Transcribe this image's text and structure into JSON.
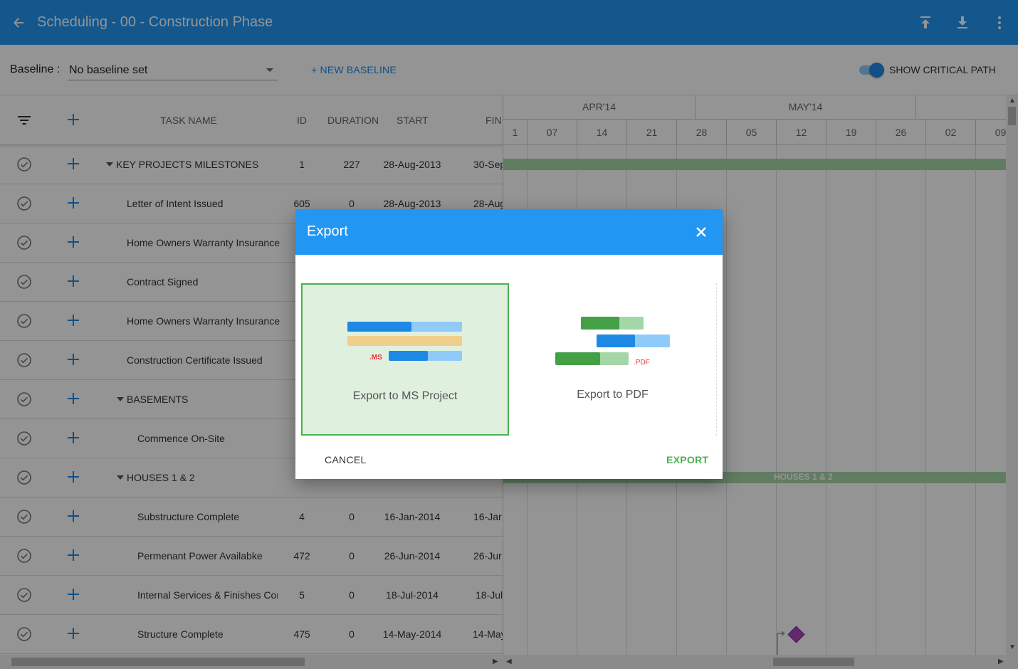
{
  "appbar": {
    "title": "Scheduling - 00 - Construction Phase",
    "icons": [
      "back-arrow-icon",
      "upload-icon",
      "download-icon",
      "more-vert-icon"
    ]
  },
  "baseline": {
    "label": "Baseline :",
    "selected": "No baseline set",
    "new_button": "+ NEW BASELINE",
    "critical_path_label": "SHOW CRITICAL PATH",
    "critical_path_on": true
  },
  "grid": {
    "columns": {
      "task_name": "TASK NAME",
      "id": "ID",
      "duration": "DURATION",
      "start": "START",
      "finish": "FIN"
    },
    "rows": [
      {
        "name": "KEY PROJECTS MILESTONES",
        "group": true,
        "indent": 0,
        "id": "1",
        "duration": "227",
        "start": "28-Aug-2013",
        "finish": "30-Sep"
      },
      {
        "name": "Letter of Intent Issued",
        "group": false,
        "indent": 1,
        "id": "605",
        "duration": "0",
        "start": "28-Aug-2013",
        "finish": "28-Aug"
      },
      {
        "name": "Home Owners Warranty Insurance",
        "group": false,
        "indent": 1,
        "id": "",
        "duration": "",
        "start": "",
        "finish": ""
      },
      {
        "name": "Contract Signed",
        "group": false,
        "indent": 1,
        "id": "",
        "duration": "",
        "start": "",
        "finish": ""
      },
      {
        "name": "Home Owners Warranty Insurance",
        "group": false,
        "indent": 1,
        "id": "",
        "duration": "",
        "start": "",
        "finish": ""
      },
      {
        "name": "Construction Certificate Issued",
        "group": false,
        "indent": 1,
        "id": "",
        "duration": "",
        "start": "",
        "finish": ""
      },
      {
        "name": "BASEMENTS",
        "group": true,
        "indent": 1,
        "id": "",
        "duration": "",
        "start": "",
        "finish": ""
      },
      {
        "name": "Commence On-Site",
        "group": false,
        "indent": 2,
        "id": "",
        "duration": "",
        "start": "",
        "finish": ""
      },
      {
        "name": "HOUSES 1 & 2",
        "group": true,
        "indent": 1,
        "id": "",
        "duration": "",
        "start": "",
        "finish": ""
      },
      {
        "name": "Substructure Complete",
        "group": false,
        "indent": 2,
        "id": "4",
        "duration": "0",
        "start": "16-Jan-2014",
        "finish": "16-Jar"
      },
      {
        "name": "Permenant Power Availabke",
        "group": false,
        "indent": 2,
        "id": "472",
        "duration": "0",
        "start": "26-Jun-2014",
        "finish": "26-Jur"
      },
      {
        "name": "Internal Services & Finishes Cor",
        "group": false,
        "indent": 2,
        "id": "5",
        "duration": "0",
        "start": "18-Jul-2014",
        "finish": "18-Jul"
      },
      {
        "name": "Structure Complete",
        "group": false,
        "indent": 2,
        "id": "475",
        "duration": "0",
        "start": "14-May-2014",
        "finish": "14-May"
      }
    ]
  },
  "timeline": {
    "months": [
      "APR'14",
      "MAY'14",
      ""
    ],
    "weeks": [
      "1",
      "07",
      "14",
      "21",
      "28",
      "05",
      "12",
      "19",
      "26",
      "02",
      "09"
    ],
    "bar_label": "HOUSES 1 & 2",
    "colors": {
      "summary": "#a5d6a7",
      "milestone": "#ab47bc"
    }
  },
  "dialog": {
    "title": "Export",
    "options": [
      {
        "label": "Export to MS Project",
        "tag": ".MS",
        "selected": true
      },
      {
        "label": "Export to PDF",
        "tag": ".PDF",
        "selected": false
      }
    ],
    "cancel": "CANCEL",
    "export": "EXPORT"
  }
}
